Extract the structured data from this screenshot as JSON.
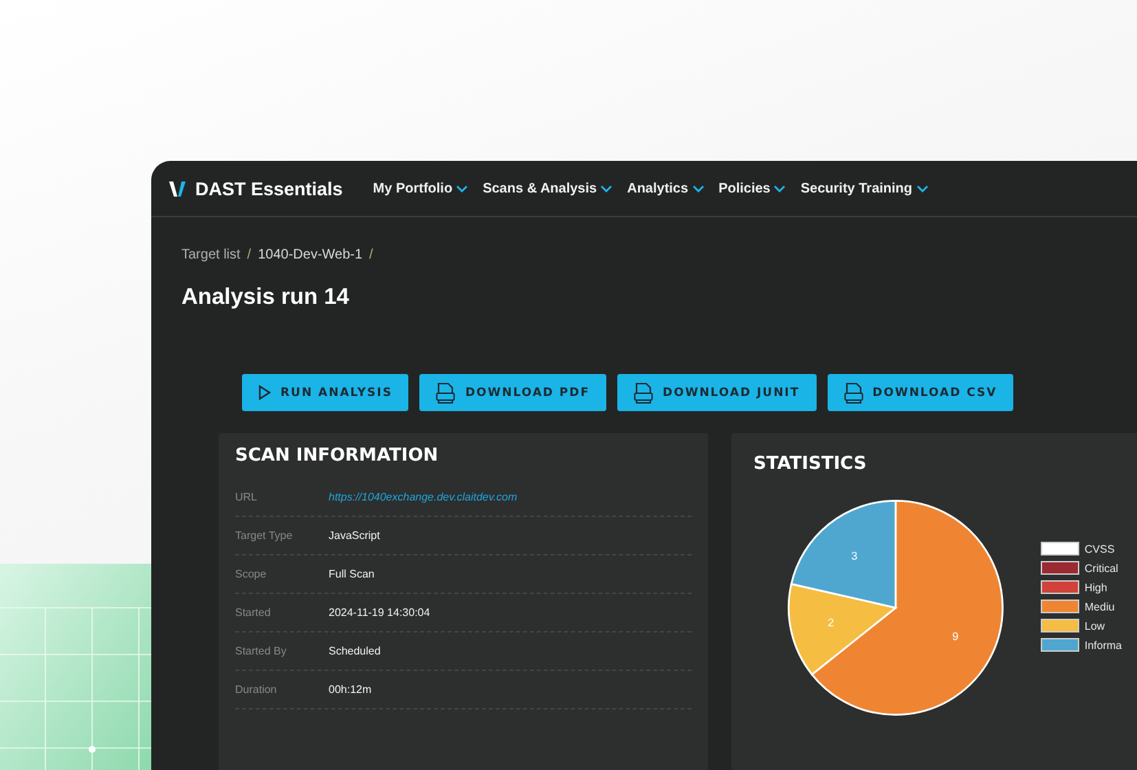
{
  "app": {
    "brand": "DAST Essentials"
  },
  "nav": [
    {
      "label": "My Portfolio"
    },
    {
      "label": "Scans & Analysis"
    },
    {
      "label": "Analytics"
    },
    {
      "label": "Policies"
    },
    {
      "label": "Security Training"
    }
  ],
  "breadcrumb": [
    {
      "label": "Target list",
      "separator": "/"
    },
    {
      "label": "1040-Dev-Web-1",
      "separator": "/"
    }
  ],
  "title": "Analysis run 14",
  "actions": [
    {
      "label": "RUN ANALYSIS",
      "kind": "play"
    },
    {
      "label": "DOWNLOAD PDF",
      "kind": "file"
    },
    {
      "label": "DOWNLOAD JUNIT",
      "kind": "file"
    },
    {
      "label": "DOWNLOAD CSV",
      "kind": "file"
    }
  ],
  "scan_information": {
    "title": "SCAN INFORMATION",
    "rows": [
      {
        "label": "URL",
        "value": "https://1040exchange.dev.claitdev.com",
        "kind": "link"
      },
      {
        "label": "Target Type",
        "value": "JavaScript",
        "kind": "text"
      },
      {
        "label": "Scope",
        "value": "Full Scan",
        "kind": "text"
      },
      {
        "label": "Started",
        "value": "2024-11-19 14:30:04",
        "kind": "text"
      },
      {
        "label": "Started By",
        "value": "Scheduled",
        "kind": "text"
      },
      {
        "label": "Duration",
        "value": "00h:12m",
        "kind": "text"
      }
    ]
  },
  "statistics": {
    "title": "STATISTICS",
    "chart_data": {
      "type": "pie",
      "categories": [
        "CVSS",
        "Critical",
        "High",
        "Mediu",
        "Low",
        "Informa"
      ],
      "series": [
        {
          "values": [
            0,
            0,
            0,
            9,
            2,
            3
          ]
        }
      ],
      "colors": [
        "#ffffff",
        "#9b2a32",
        "#d0423b",
        "#ef8532",
        "#f5bd42",
        "#4fa7d0"
      ],
      "data_labels": true,
      "legend": "right"
    }
  }
}
